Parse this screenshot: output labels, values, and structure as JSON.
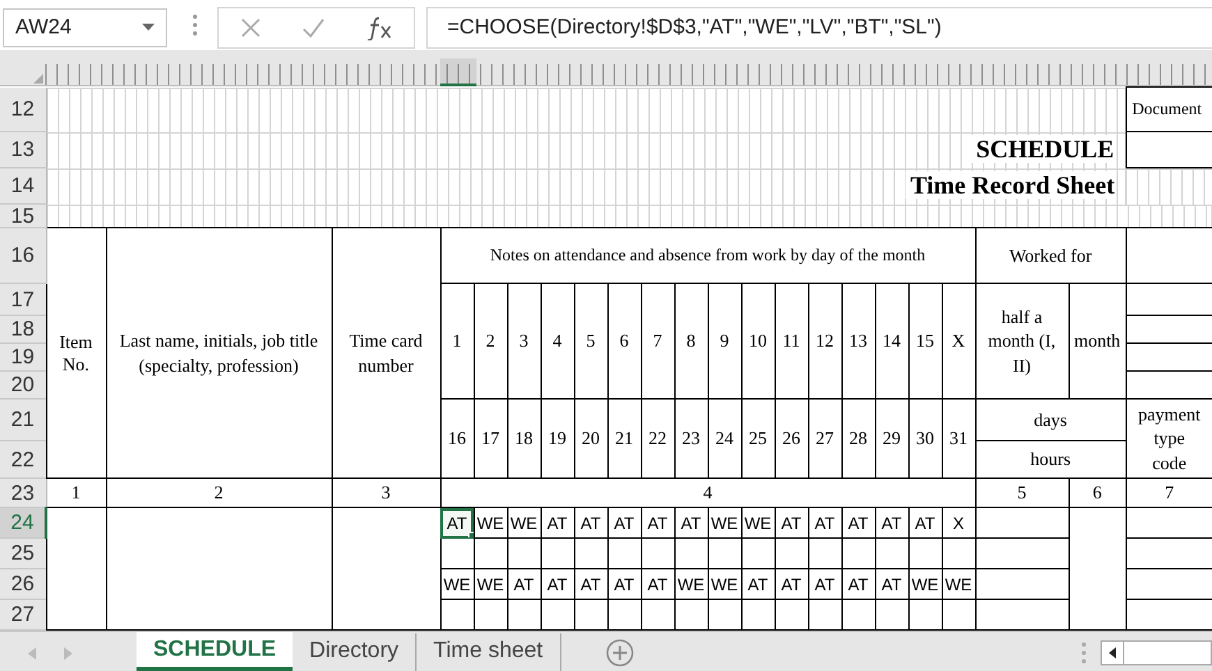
{
  "name_box": "AW24",
  "formula": "=CHOOSE(Directory!$D$3,\"AT\",\"WE\",\"LV\",\"BT\",\"SL\")",
  "document_label": "Document",
  "title": "SCHEDULE",
  "subtitle": "Time Record Sheet",
  "row_numbers": [
    {
      "label": "12",
      "selected": false
    },
    {
      "label": "13",
      "selected": false
    },
    {
      "label": "14",
      "selected": false
    },
    {
      "label": "15",
      "selected": false
    },
    {
      "label": "16",
      "selected": false
    },
    {
      "label": "17",
      "selected": false
    },
    {
      "label": "18",
      "selected": false
    },
    {
      "label": "19",
      "selected": false
    },
    {
      "label": "20",
      "selected": false
    },
    {
      "label": "21",
      "selected": false
    },
    {
      "label": "22",
      "selected": false
    },
    {
      "label": "23",
      "selected": false
    },
    {
      "label": "24",
      "selected": true
    },
    {
      "label": "25",
      "selected": false
    },
    {
      "label": "26",
      "selected": false
    },
    {
      "label": "27",
      "selected": false
    }
  ],
  "header": {
    "item_no": "Item No.",
    "name": "Last name, initials, job title (specialty, profession)",
    "time_card": "Time card number",
    "notes": "Notes on attendance and absence from work by day of the month",
    "worked_for": "Worked for",
    "half_month": "half a month (I, II)",
    "month": "month",
    "days": "days",
    "hours": "hours",
    "payment_code": "payment type code",
    "days_first": [
      "1",
      "2",
      "3",
      "4",
      "5",
      "6",
      "7",
      "8",
      "9",
      "10",
      "11",
      "12",
      "13",
      "14",
      "15",
      "X"
    ],
    "days_second": [
      "16",
      "17",
      "18",
      "19",
      "20",
      "21",
      "22",
      "23",
      "24",
      "25",
      "26",
      "27",
      "28",
      "29",
      "30",
      "31"
    ],
    "column_numbers": [
      "1",
      "2",
      "3",
      "4",
      "5",
      "6",
      "7"
    ]
  },
  "entries": [
    {
      "first_half": [
        {
          "value": "AT",
          "selected": true
        },
        {
          "value": "WE",
          "selected": false
        },
        {
          "value": "WE",
          "selected": false
        },
        {
          "value": "AT",
          "selected": false
        },
        {
          "value": "AT",
          "selected": false
        },
        {
          "value": "AT",
          "selected": false
        },
        {
          "value": "AT",
          "selected": false
        },
        {
          "value": "AT",
          "selected": false
        },
        {
          "value": "WE",
          "selected": false
        },
        {
          "value": "WE",
          "selected": false
        },
        {
          "value": "AT",
          "selected": false
        },
        {
          "value": "AT",
          "selected": false
        },
        {
          "value": "AT",
          "selected": false
        },
        {
          "value": "AT",
          "selected": false
        },
        {
          "value": "AT",
          "selected": false
        },
        {
          "value": "X",
          "selected": false
        }
      ],
      "second_half": [
        {
          "value": "WE",
          "selected": false
        },
        {
          "value": "WE",
          "selected": false
        },
        {
          "value": "AT",
          "selected": false
        },
        {
          "value": "AT",
          "selected": false
        },
        {
          "value": "AT",
          "selected": false
        },
        {
          "value": "AT",
          "selected": false
        },
        {
          "value": "AT",
          "selected": false
        },
        {
          "value": "WE",
          "selected": false
        },
        {
          "value": "WE",
          "selected": false
        },
        {
          "value": "AT",
          "selected": false
        },
        {
          "value": "AT",
          "selected": false
        },
        {
          "value": "AT",
          "selected": false
        },
        {
          "value": "AT",
          "selected": false
        },
        {
          "value": "AT",
          "selected": false
        },
        {
          "value": "WE",
          "selected": false
        },
        {
          "value": "WE",
          "selected": false
        }
      ]
    }
  ],
  "tabs": [
    {
      "label": "SCHEDULE",
      "selected": true
    },
    {
      "label": "Directory",
      "selected": false
    },
    {
      "label": "Time sheet",
      "selected": false
    }
  ]
}
